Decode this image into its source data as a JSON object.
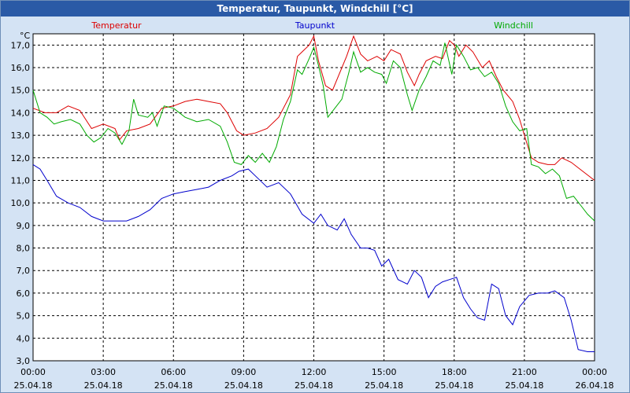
{
  "chart_data": {
    "type": "line",
    "title": "Temperatur, Taupunkt, Windchill [°C]",
    "y_unit": "°C",
    "ylim": [
      3.0,
      17.5
    ],
    "y_ticks": [
      "17,0",
      "16,0",
      "15,0",
      "14,0",
      "13,0",
      "12,0",
      "11,0",
      "10,0",
      "9,0",
      "8,0",
      "7,0",
      "6,0",
      "5,0",
      "4,0",
      "3,0"
    ],
    "y_tick_values": [
      17,
      16,
      15,
      14,
      13,
      12,
      11,
      10,
      9,
      8,
      7,
      6,
      5,
      4,
      3
    ],
    "x_ticks": [
      {
        "time": "00:00",
        "date": "25.04.18",
        "h": 0
      },
      {
        "time": "03:00",
        "date": "25.04.18",
        "h": 3
      },
      {
        "time": "06:00",
        "date": "25.04.18",
        "h": 6
      },
      {
        "time": "09:00",
        "date": "25.04.18",
        "h": 9
      },
      {
        "time": "12:00",
        "date": "25.04.18",
        "h": 12
      },
      {
        "time": "15:00",
        "date": "25.04.18",
        "h": 15
      },
      {
        "time": "18:00",
        "date": "25.04.18",
        "h": 18
      },
      {
        "time": "21:00",
        "date": "25.04.18",
        "h": 21
      },
      {
        "time": "00:00",
        "date": "26.04.18",
        "h": 24
      }
    ],
    "grid": true,
    "series": [
      {
        "name": "Temperatur",
        "color": "#dd0000",
        "points": [
          [
            0,
            14.2
          ],
          [
            0.5,
            14.0
          ],
          [
            1.0,
            14.0
          ],
          [
            1.5,
            14.3
          ],
          [
            2.0,
            14.1
          ],
          [
            2.5,
            13.3
          ],
          [
            3.0,
            13.5
          ],
          [
            3.5,
            13.3
          ],
          [
            3.7,
            12.8
          ],
          [
            4.0,
            13.2
          ],
          [
            4.5,
            13.3
          ],
          [
            5.0,
            13.5
          ],
          [
            5.5,
            14.2
          ],
          [
            6.0,
            14.3
          ],
          [
            6.5,
            14.5
          ],
          [
            7.0,
            14.6
          ],
          [
            7.5,
            14.5
          ],
          [
            8.0,
            14.4
          ],
          [
            8.3,
            14.0
          ],
          [
            8.7,
            13.2
          ],
          [
            9.0,
            13.0
          ],
          [
            9.5,
            13.1
          ],
          [
            10.0,
            13.3
          ],
          [
            10.5,
            13.8
          ],
          [
            11.0,
            14.8
          ],
          [
            11.3,
            16.5
          ],
          [
            11.5,
            16.7
          ],
          [
            11.8,
            17.0
          ],
          [
            12.0,
            17.4
          ],
          [
            12.2,
            16.3
          ],
          [
            12.5,
            15.2
          ],
          [
            12.8,
            15.0
          ],
          [
            13.0,
            15.5
          ],
          [
            13.4,
            16.5
          ],
          [
            13.7,
            17.4
          ],
          [
            14.0,
            16.6
          ],
          [
            14.3,
            16.3
          ],
          [
            14.7,
            16.5
          ],
          [
            15.0,
            16.3
          ],
          [
            15.3,
            16.8
          ],
          [
            15.7,
            16.6
          ],
          [
            16.0,
            15.8
          ],
          [
            16.3,
            15.2
          ],
          [
            16.5,
            15.7
          ],
          [
            16.8,
            16.3
          ],
          [
            17.2,
            16.5
          ],
          [
            17.5,
            16.4
          ],
          [
            17.8,
            17.2
          ],
          [
            18.0,
            17.0
          ],
          [
            18.2,
            16.5
          ],
          [
            18.5,
            17.0
          ],
          [
            18.8,
            16.7
          ],
          [
            19.2,
            16.0
          ],
          [
            19.5,
            16.3
          ],
          [
            19.8,
            15.6
          ],
          [
            20.1,
            15.0
          ],
          [
            20.5,
            14.5
          ],
          [
            20.8,
            13.7
          ],
          [
            21.0,
            13.0
          ],
          [
            21.3,
            12.0
          ],
          [
            21.6,
            11.8
          ],
          [
            22.0,
            11.7
          ],
          [
            22.3,
            11.7
          ],
          [
            22.6,
            12.0
          ],
          [
            23.0,
            11.8
          ],
          [
            23.5,
            11.4
          ],
          [
            24.0,
            11.0
          ]
        ]
      },
      {
        "name": "Taupunkt",
        "color": "#0000cc",
        "points": [
          [
            0,
            11.7
          ],
          [
            0.3,
            11.5
          ],
          [
            0.6,
            11.0
          ],
          [
            1.0,
            10.3
          ],
          [
            1.5,
            10.0
          ],
          [
            2.0,
            9.8
          ],
          [
            2.5,
            9.4
          ],
          [
            3.0,
            9.2
          ],
          [
            3.5,
            9.2
          ],
          [
            4.0,
            9.2
          ],
          [
            4.5,
            9.4
          ],
          [
            5.0,
            9.7
          ],
          [
            5.5,
            10.2
          ],
          [
            6.0,
            10.4
          ],
          [
            6.5,
            10.5
          ],
          [
            7.0,
            10.6
          ],
          [
            7.5,
            10.7
          ],
          [
            8.0,
            11.0
          ],
          [
            8.5,
            11.2
          ],
          [
            8.8,
            11.4
          ],
          [
            9.2,
            11.5
          ],
          [
            9.5,
            11.2
          ],
          [
            10.0,
            10.7
          ],
          [
            10.5,
            10.9
          ],
          [
            11.0,
            10.4
          ],
          [
            11.5,
            9.5
          ],
          [
            12.0,
            9.1
          ],
          [
            12.3,
            9.5
          ],
          [
            12.6,
            9.0
          ],
          [
            13.0,
            8.8
          ],
          [
            13.3,
            9.3
          ],
          [
            13.6,
            8.6
          ],
          [
            14.0,
            8.0
          ],
          [
            14.3,
            8.0
          ],
          [
            14.6,
            7.9
          ],
          [
            14.9,
            7.2
          ],
          [
            15.2,
            7.5
          ],
          [
            15.6,
            6.6
          ],
          [
            16.0,
            6.4
          ],
          [
            16.3,
            7.0
          ],
          [
            16.6,
            6.7
          ],
          [
            16.9,
            5.8
          ],
          [
            17.2,
            6.3
          ],
          [
            17.5,
            6.5
          ],
          [
            17.8,
            6.6
          ],
          [
            18.1,
            6.7
          ],
          [
            18.4,
            5.8
          ],
          [
            18.7,
            5.3
          ],
          [
            19.0,
            4.9
          ],
          [
            19.3,
            4.8
          ],
          [
            19.6,
            6.4
          ],
          [
            19.9,
            6.2
          ],
          [
            20.2,
            5.0
          ],
          [
            20.5,
            4.6
          ],
          [
            20.8,
            5.4
          ],
          [
            21.2,
            5.9
          ],
          [
            21.6,
            6.0
          ],
          [
            22.0,
            6.0
          ],
          [
            22.3,
            6.1
          ],
          [
            22.7,
            5.8
          ],
          [
            23.0,
            4.8
          ],
          [
            23.3,
            3.5
          ],
          [
            23.7,
            3.4
          ],
          [
            24.0,
            3.4
          ]
        ]
      },
      {
        "name": "Windchill",
        "color": "#00aa00",
        "points": [
          [
            0,
            15.0
          ],
          [
            0.3,
            14.0
          ],
          [
            0.6,
            13.8
          ],
          [
            0.9,
            13.5
          ],
          [
            1.2,
            13.6
          ],
          [
            1.6,
            13.7
          ],
          [
            2.0,
            13.5
          ],
          [
            2.3,
            13.0
          ],
          [
            2.6,
            12.7
          ],
          [
            2.9,
            12.9
          ],
          [
            3.2,
            13.3
          ],
          [
            3.5,
            13.1
          ],
          [
            3.8,
            12.6
          ],
          [
            4.1,
            13.2
          ],
          [
            4.3,
            14.6
          ],
          [
            4.5,
            13.9
          ],
          [
            4.9,
            13.8
          ],
          [
            5.1,
            14.0
          ],
          [
            5.3,
            13.4
          ],
          [
            5.6,
            14.3
          ],
          [
            6.0,
            14.2
          ],
          [
            6.5,
            13.8
          ],
          [
            7.0,
            13.6
          ],
          [
            7.5,
            13.7
          ],
          [
            8.0,
            13.4
          ],
          [
            8.3,
            12.7
          ],
          [
            8.6,
            11.8
          ],
          [
            8.9,
            11.7
          ],
          [
            9.2,
            12.1
          ],
          [
            9.5,
            11.8
          ],
          [
            9.8,
            12.2
          ],
          [
            10.1,
            11.8
          ],
          [
            10.4,
            12.5
          ],
          [
            10.7,
            13.7
          ],
          [
            11.0,
            14.5
          ],
          [
            11.3,
            15.9
          ],
          [
            11.5,
            15.7
          ],
          [
            11.8,
            16.4
          ],
          [
            12.0,
            16.9
          ],
          [
            12.2,
            16.1
          ],
          [
            12.4,
            15.2
          ],
          [
            12.6,
            13.8
          ],
          [
            12.9,
            14.2
          ],
          [
            13.2,
            14.6
          ],
          [
            13.5,
            15.8
          ],
          [
            13.7,
            16.7
          ],
          [
            14.0,
            15.8
          ],
          [
            14.3,
            16.0
          ],
          [
            14.6,
            15.8
          ],
          [
            14.9,
            15.7
          ],
          [
            15.1,
            15.3
          ],
          [
            15.4,
            16.3
          ],
          [
            15.7,
            16.0
          ],
          [
            16.0,
            14.8
          ],
          [
            16.2,
            14.1
          ],
          [
            16.5,
            15.0
          ],
          [
            16.8,
            15.6
          ],
          [
            17.1,
            16.3
          ],
          [
            17.4,
            16.1
          ],
          [
            17.6,
            17.1
          ],
          [
            17.9,
            15.7
          ],
          [
            18.1,
            17.0
          ],
          [
            18.4,
            16.5
          ],
          [
            18.7,
            15.9
          ],
          [
            19.0,
            16.0
          ],
          [
            19.3,
            15.6
          ],
          [
            19.6,
            15.8
          ],
          [
            19.9,
            15.3
          ],
          [
            20.2,
            14.3
          ],
          [
            20.5,
            13.6
          ],
          [
            20.8,
            13.2
          ],
          [
            21.1,
            13.3
          ],
          [
            21.3,
            11.7
          ],
          [
            21.6,
            11.6
          ],
          [
            21.9,
            11.3
          ],
          [
            22.2,
            11.5
          ],
          [
            22.5,
            11.2
          ],
          [
            22.8,
            10.2
          ],
          [
            23.1,
            10.3
          ],
          [
            23.4,
            9.9
          ],
          [
            23.7,
            9.5
          ],
          [
            24.0,
            9.2
          ]
        ]
      }
    ]
  }
}
